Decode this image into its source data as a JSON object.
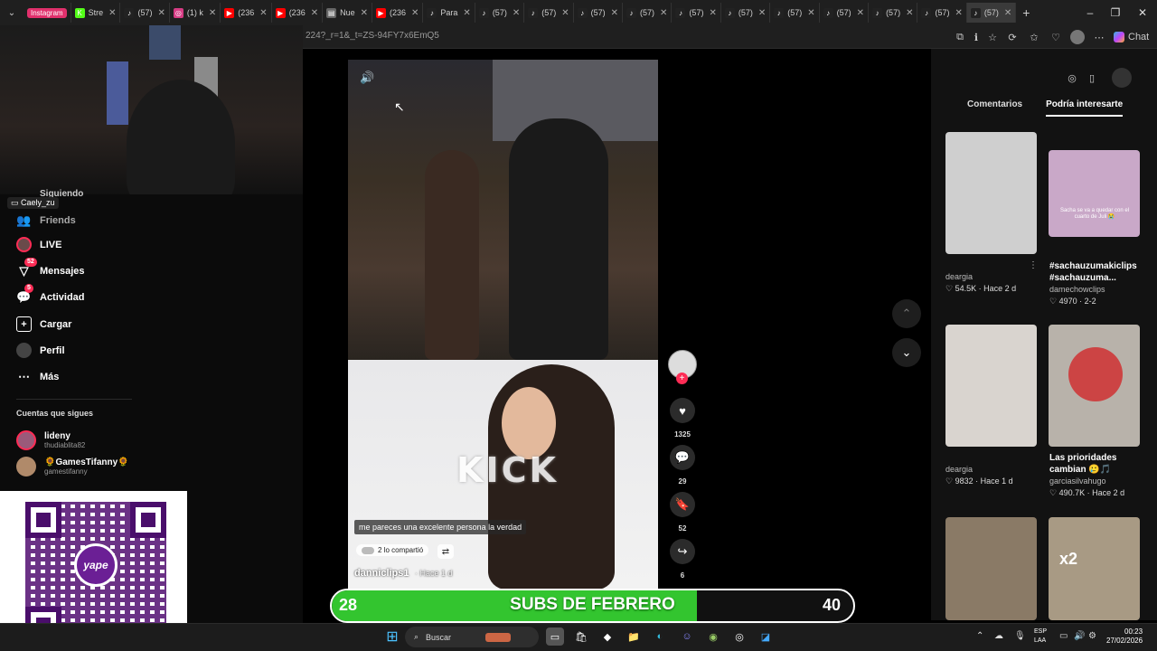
{
  "browser": {
    "tabs": [
      {
        "label": "Instagram",
        "icon": "instagram-icon",
        "kind": "pill"
      },
      {
        "label": "Stre",
        "icon": "kick-icon"
      },
      {
        "label": "(57)",
        "icon": "tiktok-icon"
      },
      {
        "label": "(1) k",
        "icon": "instagram-icon"
      },
      {
        "label": "(236",
        "icon": "youtube-icon"
      },
      {
        "label": "(236",
        "icon": "youtube-icon"
      },
      {
        "label": "Nue",
        "icon": "page-icon"
      },
      {
        "label": "(236",
        "icon": "youtube-icon"
      },
      {
        "label": "Para",
        "icon": "tiktok-icon"
      },
      {
        "label": "(57)",
        "icon": "tiktok-icon"
      },
      {
        "label": "(57)",
        "icon": "tiktok-icon"
      },
      {
        "label": "(57)",
        "icon": "tiktok-icon"
      },
      {
        "label": "(57)",
        "icon": "tiktok-icon"
      },
      {
        "label": "(57)",
        "icon": "tiktok-icon"
      },
      {
        "label": "(57)",
        "icon": "tiktok-icon"
      },
      {
        "label": "(57)",
        "icon": "tiktok-icon"
      },
      {
        "label": "(57)",
        "icon": "tiktok-icon"
      },
      {
        "label": "(57)",
        "icon": "tiktok-icon"
      },
      {
        "label": "(57)",
        "icon": "tiktok-icon"
      },
      {
        "label": "(57)",
        "icon": "tiktok-icon"
      }
    ],
    "url": "224?_r=1&_t=ZS-94FY7x6EmQ5",
    "chat_label": "Chat"
  },
  "sidebar": {
    "partial_label": "Siguiendo",
    "streamer_tag": "Caely_zu",
    "items": [
      {
        "label": "Friends",
        "icon": "friends-icon"
      },
      {
        "label": "LIVE",
        "icon": "live-icon"
      },
      {
        "label": "Mensajes",
        "icon": "messages-icon",
        "badge": "52"
      },
      {
        "label": "Actividad",
        "icon": "activity-icon",
        "badge": "5"
      },
      {
        "label": "Cargar",
        "icon": "upload-icon"
      },
      {
        "label": "Perfil",
        "icon": "profile-icon"
      },
      {
        "label": "Más",
        "icon": "more-icon"
      }
    ],
    "following_heading": "Cuentas que sigues",
    "following": [
      {
        "name": "lideny",
        "handle": "thudiablita82"
      },
      {
        "name": "🌻GamesTifanny🌻",
        "handle": "gamestifanny"
      }
    ]
  },
  "qr": {
    "brand": "yape"
  },
  "video": {
    "watermark": "KICK",
    "caption": "me pareces una excelente persona la verdad",
    "shared": "2 lo compartió",
    "author": "danniclips1",
    "time": "Hace 1 d",
    "likes": "1325",
    "comments": "29",
    "saves": "52",
    "shares": "6"
  },
  "right_panel": {
    "tab_comments": "Comentarios",
    "tab_suggested": "Podría interesarte",
    "items": [
      {
        "title": "",
        "author": "deargia",
        "likes": "54.5K",
        "time": "Hace 2 d",
        "color": "#cfcfcf"
      },
      {
        "title": "#sachauzumakiclips #sachauzuma...",
        "author": "damechowclips",
        "likes": "4970",
        "time": "2-2",
        "color": "#c9a8c8",
        "overlay": "Sacha se va a quedar con el cuarto de Juli 😭"
      },
      {
        "title": "",
        "author": "deargia",
        "likes": "9832",
        "time": "Hace 1 d",
        "color": "#d9d4cf"
      },
      {
        "title": "Las prioridades cambian 🥲🎵",
        "author": "garciasilvahugo",
        "likes": "490.7K",
        "time": "Hace 2 d",
        "color": "#b8b2aa"
      },
      {
        "title": "",
        "author": "",
        "likes": "",
        "time": "",
        "color": "#8a7a66"
      },
      {
        "title": "",
        "author": "",
        "likes": "",
        "time": "",
        "color": "#a89a84",
        "overlay": "x2"
      }
    ]
  },
  "subs": {
    "current": "28",
    "title": "SUBS DE FEBRERO",
    "goal": "40",
    "progress": 0.7,
    "fill_color": "#33c52f"
  },
  "taskbar": {
    "search_placeholder": "Buscar",
    "lang": "ESP",
    "lang2": "LAA",
    "time": "00:23",
    "date": "27/02/2026"
  }
}
